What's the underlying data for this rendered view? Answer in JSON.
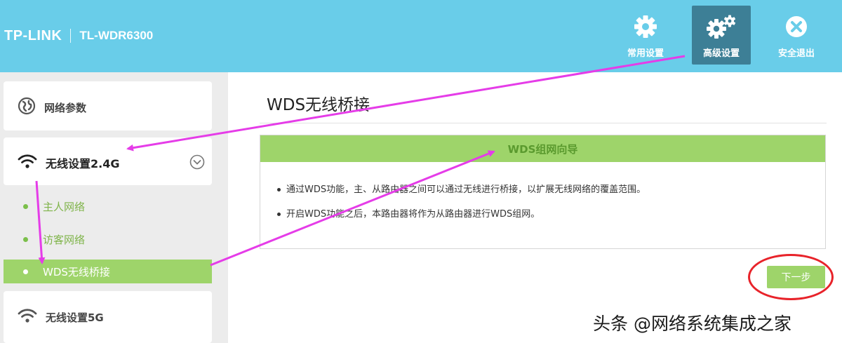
{
  "header": {
    "brand": "TP-LINK",
    "model": "TL-WDR6300",
    "nav": {
      "common": "常用设置",
      "advanced": "高级设置",
      "logout": "安全退出"
    }
  },
  "sidebar": {
    "network": "网络参数",
    "wireless24": "无线设置2.4G",
    "sub_items": [
      "主人网络",
      "访客网络",
      "WDS无线桥接"
    ],
    "wireless5": "无线设置5G"
  },
  "main": {
    "title": "WDS无线桥接",
    "panel": {
      "heading": "WDS组网向导",
      "bullets": [
        "通过WDS功能，主、从路由器之间可以通过无线进行桥接，以扩展无线网络的覆盖范围。",
        "开启WDS功能之后，本路由器将作为从路由器进行WDS组网。"
      ]
    },
    "next_button": "下一步"
  },
  "watermark": "头条 @网络系统集成之家",
  "colors": {
    "header": "#69cde9",
    "active_nav": "#3d7f96",
    "green": "#9ed46a",
    "annotation_arrow": "#e53ce8",
    "annotation_circle": "#e8232a"
  }
}
